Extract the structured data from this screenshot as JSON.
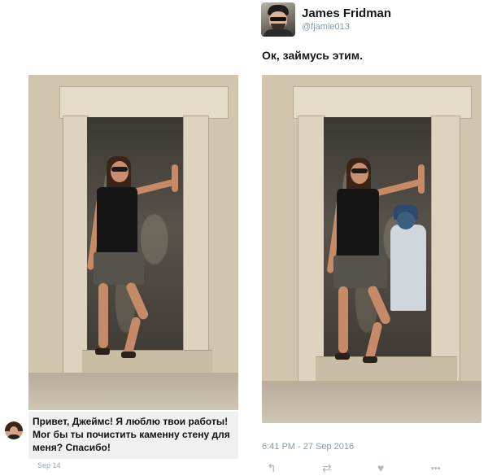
{
  "author": {
    "name": "James Fridman",
    "handle": "@fjamie013"
  },
  "tweet": {
    "text": "Ок, займусь этим.",
    "timestamp": "6:41 PM - 27 Sep 2016"
  },
  "message": {
    "text": "Привет, Джеймс! Я люблю твои работы! Мог бы ты почистить каменну стену для меня? Спасибо!",
    "date": "Sep 14"
  },
  "actions": [
    {
      "icon": "reply-icon",
      "glyph": "↰"
    },
    {
      "icon": "retweet-icon",
      "glyph": "⇄"
    },
    {
      "icon": "like-icon",
      "glyph": "♥"
    },
    {
      "icon": "more-icon",
      "glyph": "•••"
    }
  ],
  "colors": {
    "text_primary": "#14171a",
    "text_secondary": "#8899a6",
    "action_grey": "#aab8c2",
    "bubble_bg": "#f0f0f0"
  }
}
